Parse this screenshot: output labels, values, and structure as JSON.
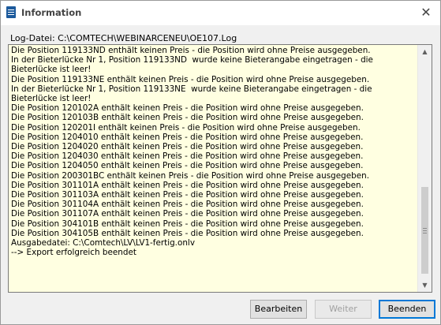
{
  "window": {
    "title": "Information",
    "close_glyph": "✕",
    "icon": "document-list-icon"
  },
  "log_file": {
    "label": "Log-Datei: C:\\COMTECH\\WEBINARCENEU\\OE107.Log"
  },
  "log": {
    "lines": [
      "Die Position 119133ND enthält keinen Preis - die Position wird ohne Preise ausgegeben.",
      "In der Bieterlücke Nr 1, Position 119133ND  wurde keine Bieterangabe eingetragen - die Bieterlücke ist leer!",
      "Die Position 119133NE enthält keinen Preis - die Position wird ohne Preise ausgegeben.",
      "In der Bieterlücke Nr 1, Position 119133NE  wurde keine Bieterangabe eingetragen - die Bieterlücke ist leer!",
      "Die Position 120102A enthält keinen Preis - die Position wird ohne Preise ausgegeben.",
      "Die Position 120103B enthält keinen Preis - die Position wird ohne Preise ausgegeben.",
      "Die Position 120201I enthält keinen Preis - die Position wird ohne Preise ausgegeben.",
      "Die Position 1204010 enthält keinen Preis - die Position wird ohne Preise ausgegeben.",
      "Die Position 1204020 enthält keinen Preis - die Position wird ohne Preise ausgegeben.",
      "Die Position 1204030 enthält keinen Preis - die Position wird ohne Preise ausgegeben.",
      "Die Position 1204050 enthält keinen Preis - die Position wird ohne Preise ausgegeben.",
      "Die Position 200301BC enthält keinen Preis - die Position wird ohne Preise ausgegeben.",
      "Die Position 301101A enthält keinen Preis - die Position wird ohne Preise ausgegeben.",
      "Die Position 301103A enthält keinen Preis - die Position wird ohne Preise ausgegeben.",
      "Die Position 301104A enthält keinen Preis - die Position wird ohne Preise ausgegeben.",
      "Die Position 301107A enthält keinen Preis - die Position wird ohne Preise ausgegeben.",
      "Die Position 304101B enthält keinen Preis - die Position wird ohne Preise ausgegeben.",
      "Die Position 304105B enthält keinen Preis - die Position wird ohne Preise ausgegeben.",
      "Ausgabedatei: C:\\Comtech\\LV\\LV1-fertig.onlv",
      "--> Export erfolgreich beendet"
    ]
  },
  "scrollbar": {
    "up_glyph": "▲",
    "down_glyph": "▼"
  },
  "buttons": {
    "edit_label": "Bearbeiten",
    "next_label": "Weiter",
    "finish_label": "Beenden"
  },
  "colors": {
    "log_background": "#ffffe1",
    "focus_border": "#0078d7",
    "icon_blue": "#1c5a9c"
  }
}
